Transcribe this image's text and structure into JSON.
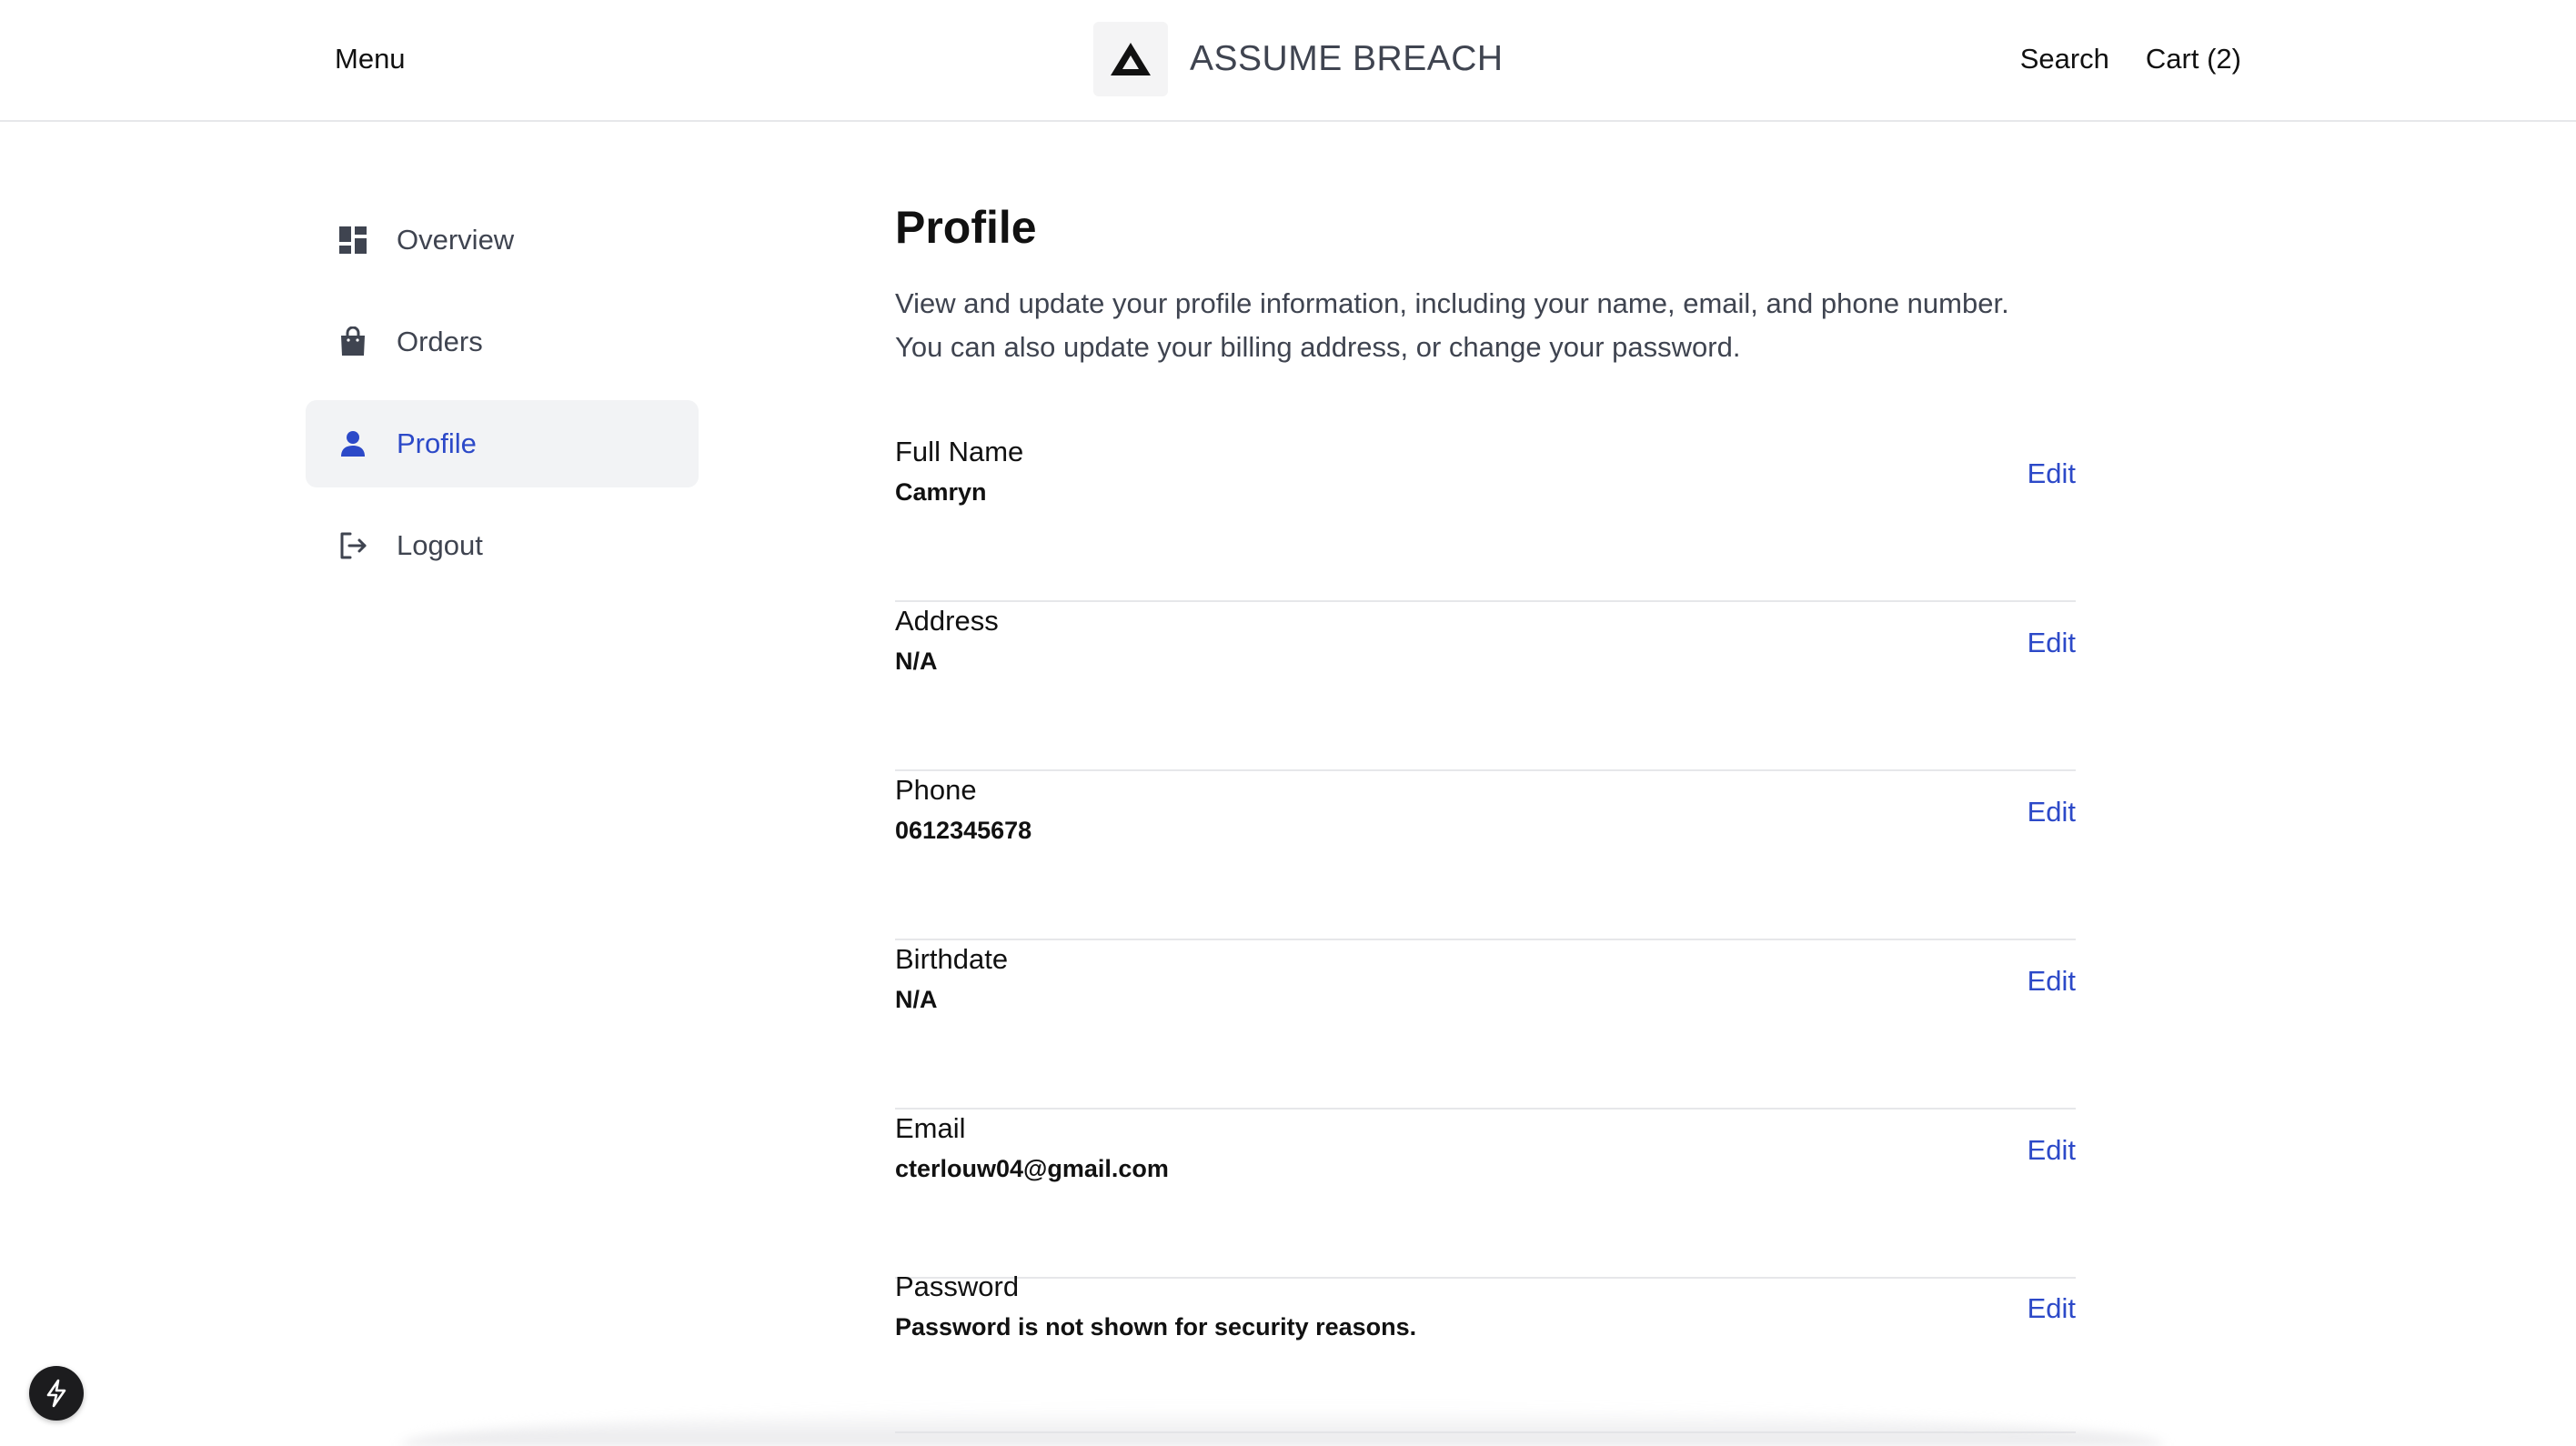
{
  "header": {
    "menu_label": "Menu",
    "brand_name": "ASSUME BREACH",
    "search_label": "Search",
    "cart_label": "Cart (2)"
  },
  "sidebar": {
    "items": [
      {
        "label": "Overview",
        "icon": "dashboard-icon",
        "active": false
      },
      {
        "label": "Orders",
        "icon": "shopping-bag-icon",
        "active": false
      },
      {
        "label": "Profile",
        "icon": "user-icon",
        "active": true
      },
      {
        "label": "Logout",
        "icon": "logout-icon",
        "active": false
      }
    ]
  },
  "main": {
    "title": "Profile",
    "description_line1": "View and update your profile information, including your name, email, and phone number.",
    "description_line2": "You can also update your billing address, or change your password.",
    "edit_label": "Edit",
    "fields": [
      {
        "label": "Full Name",
        "value": "Camryn"
      },
      {
        "label": "Address",
        "value": "N/A"
      },
      {
        "label": "Phone",
        "value": "0612345678"
      },
      {
        "label": "Birthdate",
        "value": "N/A"
      },
      {
        "label": "Email",
        "value": "cterlouw04@gmail.com"
      },
      {
        "label": "Password",
        "value": "Password is not shown for security reasons."
      }
    ]
  },
  "colors": {
    "accent": "#2c49c8",
    "text": "#111111",
    "muted_text": "#3f4450",
    "active_bg": "#f2f3f5",
    "divider": "#e6e7ea"
  },
  "floating_button_icon": "lightning-bolt-icon"
}
